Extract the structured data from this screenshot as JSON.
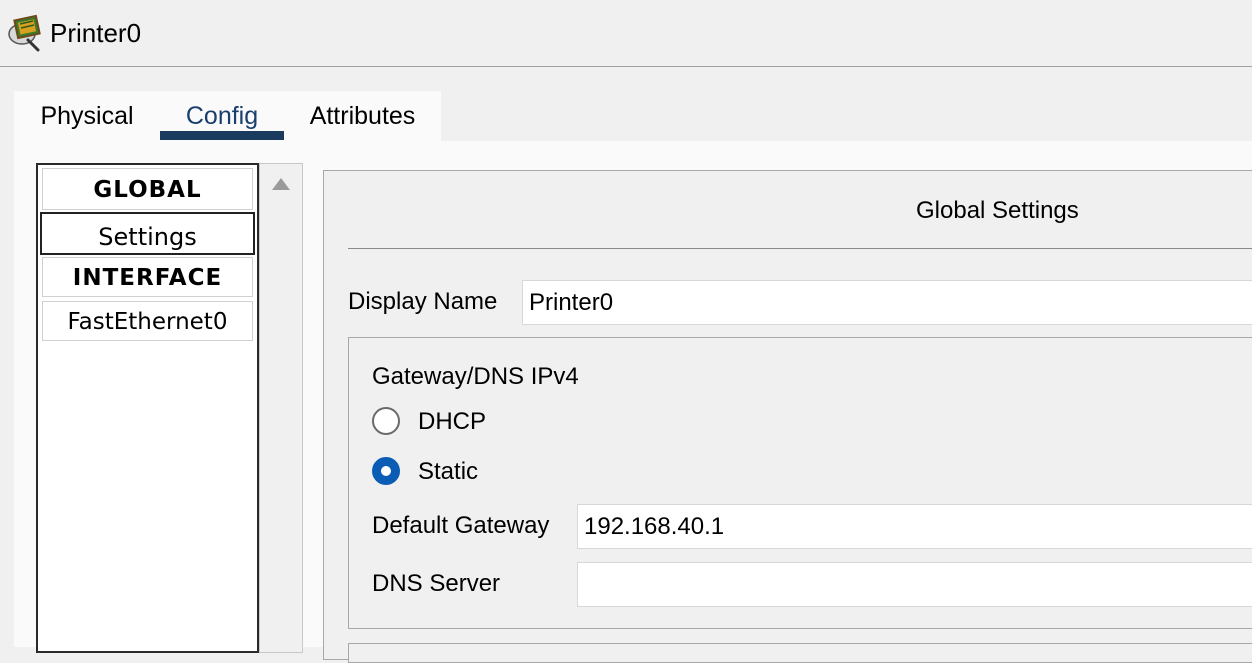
{
  "window": {
    "title": "Printer0",
    "icon": "printer-device-icon"
  },
  "tabs": [
    {
      "label": "Physical",
      "active": false
    },
    {
      "label": "Config",
      "active": true
    },
    {
      "label": "Attributes",
      "active": false
    }
  ],
  "sidebar": {
    "items": [
      {
        "label": "GLOBAL",
        "type": "header"
      },
      {
        "label": "Settings",
        "type": "item",
        "selected": true
      },
      {
        "label": "INTERFACE",
        "type": "header"
      },
      {
        "label": "FastEthernet0",
        "type": "item",
        "selected": false
      }
    ]
  },
  "main": {
    "section_title": "Global Settings",
    "display_name": {
      "label": "Display Name",
      "value": "Printer0"
    },
    "gateway_group": {
      "title": "Gateway/DNS IPv4",
      "dhcp_label": "DHCP",
      "static_label": "Static",
      "selected_mode": "Static",
      "default_gateway_label": "Default Gateway",
      "default_gateway_value": "192.168.40.1",
      "dns_server_label": "DNS Server",
      "dns_server_value": ""
    }
  },
  "colors": {
    "accent_blue": "#0b5cb5",
    "tab_underline": "#1a3b5e",
    "background": "#f0f0f0"
  }
}
